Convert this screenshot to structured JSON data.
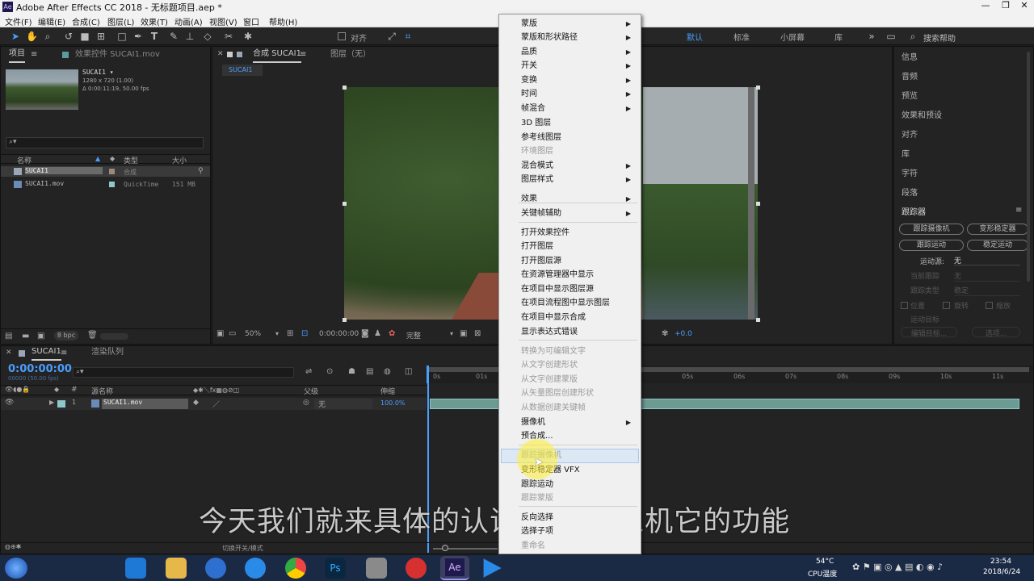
{
  "window": {
    "title": "Adobe After Effects CC 2018 - 无标题项目.aep *",
    "app_badge": "Ae"
  },
  "menu": [
    "文件(F)",
    "编辑(E)",
    "合成(C)",
    "图层(L)",
    "效果(T)",
    "动画(A)",
    "视图(V)",
    "窗口",
    "帮助(H)"
  ],
  "toolbar": {
    "align_label": "对齐",
    "search_help": "搜索帮助"
  },
  "workspaces": [
    "默认",
    "标准",
    "小屏幕",
    "库"
  ],
  "project": {
    "tab_label": "项目",
    "effects_tab": "效果控件 SUCAI1.mov",
    "item_name": "SUCAI1 ▾",
    "item_dims": "1280 x 720 (1.00)",
    "item_dur": "Δ 0:00:11:19, 50.00 fps",
    "search_icon": "⌕▾",
    "col_name": "名称",
    "col_type": "类型",
    "col_size": "大小",
    "rows": [
      {
        "name": "SUCAI1",
        "type": "合成",
        "size": ""
      },
      {
        "name": "SUCAI1.mov",
        "type": "QuickTime",
        "size": "151 MB"
      }
    ],
    "bpc": "8 bpc"
  },
  "composition": {
    "tab_label": "合成 SUCAI1",
    "tab_menu": "≡",
    "layer_tab": "图层（无）",
    "sub_tab": "SUCAI1",
    "zoom": "50%",
    "timecode": "0:00:00:00",
    "quality": "完整",
    "exposure": "+0.0"
  },
  "timeline": {
    "tab_label": "SUCAI1",
    "render_queue": "渲染队列",
    "timecode": "0:00:00:00",
    "fps": "00000 (50.00 fps)",
    "col_num": "#",
    "col_source": "源名称",
    "col_parent": "父级",
    "col_stretch": "伸缩",
    "layer": {
      "num": "1",
      "name": "SUCAI1.mov",
      "parent": "无",
      "stretch": "100.0%"
    },
    "ruler": [
      "0s",
      "01s",
      "05s",
      "06s",
      "07s",
      "08s",
      "09s",
      "10s",
      "11s"
    ],
    "bottom_label": "切换开关/模式"
  },
  "right_panel": {
    "items": [
      "信息",
      "音频",
      "预览",
      "效果和预设",
      "对齐",
      "库",
      "字符",
      "段落"
    ],
    "tracker_title": "跟踪器",
    "btn_track_camera": "跟踪摄像机",
    "btn_warp_stabilizer": "变形稳定器",
    "btn_track_motion": "跟踪运动",
    "btn_stabilize_motion": "稳定运动",
    "motion_source_label": "运动源:",
    "motion_source_value": "无",
    "current_track_label": "当前跟踪",
    "current_track_value": "无",
    "track_type_label": "跟踪类型",
    "track_type_value": "稳定",
    "chk_position": "位置",
    "chk_rotation": "旋转",
    "chk_scale": "缩放",
    "motion_target": "运动目标",
    "edit_target": "编辑目标...",
    "options": "选项..."
  },
  "context_menu": [
    {
      "label": "蒙版",
      "sub": true
    },
    {
      "label": "蒙版和形状路径",
      "sub": true
    },
    {
      "label": "品质",
      "sub": true
    },
    {
      "label": "开关",
      "sub": true
    },
    {
      "label": "变换",
      "sub": true
    },
    {
      "label": "时间",
      "sub": true
    },
    {
      "label": "帧混合",
      "sub": true
    },
    {
      "label": "3D 图层"
    },
    {
      "label": "参考线图层"
    },
    {
      "label": "环境图层",
      "disabled": true
    },
    {
      "label": "混合模式",
      "sub": true
    },
    {
      "label": "图层样式",
      "sub": true
    },
    {
      "label": "效果",
      "sub": true
    },
    {
      "label": "关键帧辅助",
      "sub": true
    },
    {
      "label": "打开效果控件"
    },
    {
      "label": "打开图层"
    },
    {
      "label": "打开图层源"
    },
    {
      "label": "在资源管理器中显示"
    },
    {
      "label": "在项目中显示图层源"
    },
    {
      "label": "在项目流程图中显示图层"
    },
    {
      "label": "在项目中显示合成"
    },
    {
      "label": "显示表达式错误"
    },
    {
      "label": "转换为可编辑文字",
      "disabled": true
    },
    {
      "label": "从文字创建形状",
      "disabled": true
    },
    {
      "label": "从文字创建蒙版",
      "disabled": true
    },
    {
      "label": "从矢量图层创建形状",
      "disabled": true
    },
    {
      "label": "从数据创建关键帧",
      "disabled": true
    },
    {
      "label": "摄像机",
      "sub": true
    },
    {
      "label": "预合成..."
    },
    {
      "label": "跟踪摄像机",
      "disabled": true
    },
    {
      "label": "变形稳定器 VFX"
    },
    {
      "label": "跟踪运动"
    },
    {
      "label": "跟踪蒙版",
      "disabled": true
    },
    {
      "label": "反向选择"
    },
    {
      "label": "选择子项"
    },
    {
      "label": "重命名",
      "disabled": true
    }
  ],
  "subtitle": "今天我们就来具体的认识 跟踪摄像机它的功能",
  "taskbar": {
    "temp": "54°C",
    "cpu": "CPU温度",
    "time": "23:54",
    "date": "2018/6/24"
  }
}
